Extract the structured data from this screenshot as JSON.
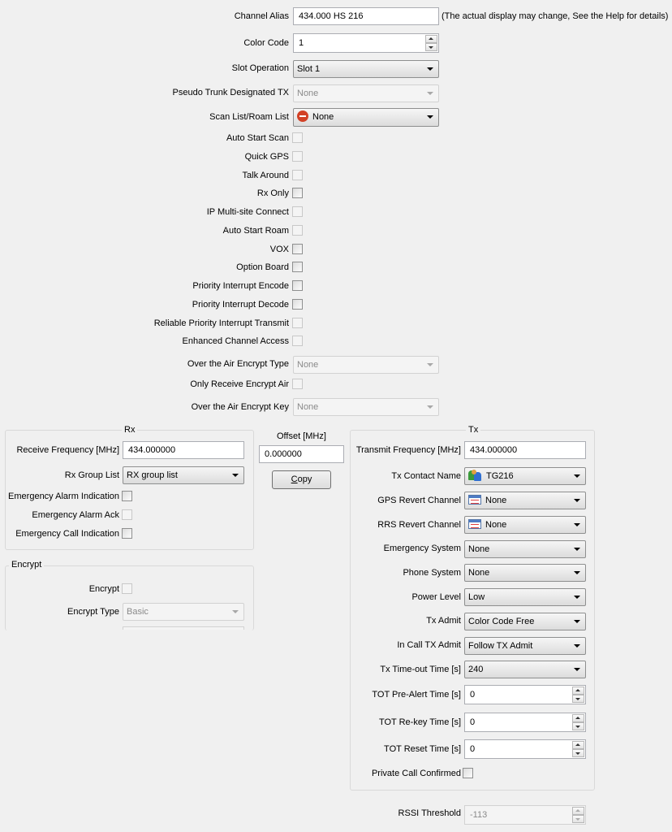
{
  "top": {
    "channel_alias": {
      "label": "Channel Alias",
      "value": "434.000 HS 216",
      "note": "(The actual display may change, See the Help for details)"
    },
    "color_code": {
      "label": "Color Code",
      "value": "1"
    },
    "slot_operation": {
      "label": "Slot Operation",
      "value": "Slot 1"
    },
    "pseudo_trunk": {
      "label": "Pseudo Trunk Designated TX",
      "value": "None"
    },
    "scan_list": {
      "label": "Scan List/Roam List",
      "value": "None",
      "icon": "none-icon"
    },
    "checkboxes": [
      {
        "label": "Auto Start Scan",
        "checked": false,
        "enabled": false
      },
      {
        "label": "Quick GPS",
        "checked": false,
        "enabled": false
      },
      {
        "label": "Talk Around",
        "checked": false,
        "enabled": false
      },
      {
        "label": "Rx Only",
        "checked": false,
        "enabled": true
      },
      {
        "label": "IP Multi-site Connect",
        "checked": false,
        "enabled": false
      },
      {
        "label": "Auto Start Roam",
        "checked": false,
        "enabled": false
      },
      {
        "label": "VOX",
        "checked": false,
        "enabled": true
      },
      {
        "label": "Option Board",
        "checked": false,
        "enabled": true
      },
      {
        "label": "Priority Interrupt Encode",
        "checked": false,
        "enabled": true
      },
      {
        "label": "Priority Interrupt Decode",
        "checked": false,
        "enabled": true
      },
      {
        "label": "Reliable Priority Interrupt Transmit",
        "checked": false,
        "enabled": false
      },
      {
        "label": "Enhanced Channel Access",
        "checked": false,
        "enabled": false
      }
    ],
    "ota_encrypt_type": {
      "label": "Over the Air Encrypt Type",
      "value": "None"
    },
    "only_receive_encrypt": {
      "label": "Only Receive Encrypt Air",
      "checked": false
    },
    "ota_encrypt_key": {
      "label": "Over the Air Encrypt Key",
      "value": "None"
    }
  },
  "rx": {
    "title": "Rx",
    "receive_frequency": {
      "label": "Receive Frequency [MHz]",
      "value": "434.000000"
    },
    "rx_group_list": {
      "label": "Rx Group List",
      "value": "RX group list"
    },
    "checkboxes": [
      {
        "label": "Emergency Alarm Indication",
        "checked": false,
        "enabled": true
      },
      {
        "label": "Emergency Alarm Ack",
        "checked": false,
        "enabled": false
      },
      {
        "label": "Emergency Call Indication",
        "checked": false,
        "enabled": true
      }
    ]
  },
  "offset": {
    "label": "Offset [MHz]",
    "value": "0.000000",
    "copy_label": "Copy",
    "copy_mnemonic": "C"
  },
  "encrypt": {
    "title": "Encrypt",
    "encrypt": {
      "label": "Encrypt",
      "checked": false
    },
    "encrypt_type": {
      "label": "Encrypt Type",
      "value": "Basic"
    }
  },
  "tx": {
    "title": "Tx",
    "transmit_frequency": {
      "label": "Transmit Frequency [MHz]",
      "value": "434.000000"
    },
    "tx_contact": {
      "label": "Tx Contact Name",
      "value": "TG216",
      "icon": "group-contact-icon"
    },
    "gps_revert": {
      "label": "GPS Revert Channel",
      "value": "None",
      "icon": "channel-icon"
    },
    "rrs_revert": {
      "label": "RRS Revert Channel",
      "value": "None",
      "icon": "channel-icon"
    },
    "emergency_system": {
      "label": "Emergency System",
      "value": "None"
    },
    "phone_system": {
      "label": "Phone System",
      "value": "None"
    },
    "power_level": {
      "label": "Power Level",
      "value": "Low"
    },
    "tx_admit": {
      "label": "Tx Admit",
      "value": "Color Code Free"
    },
    "in_call_tx_admit": {
      "label": "In Call TX Admit",
      "value": "Follow TX Admit"
    },
    "tx_timeout": {
      "label": "Tx Time-out Time [s]",
      "value": "240"
    },
    "tot_pre_alert": {
      "label": "TOT Pre-Alert Time [s]",
      "value": "0"
    },
    "tot_rekey": {
      "label": "TOT Re-key Time [s]",
      "value": "0"
    },
    "tot_reset": {
      "label": "TOT Reset Time [s]",
      "value": "0"
    },
    "private_call_confirmed": {
      "label": "Private Call Confirmed",
      "checked": false
    }
  },
  "rssi": {
    "label": "RSSI Threshold",
    "value": "-113"
  }
}
